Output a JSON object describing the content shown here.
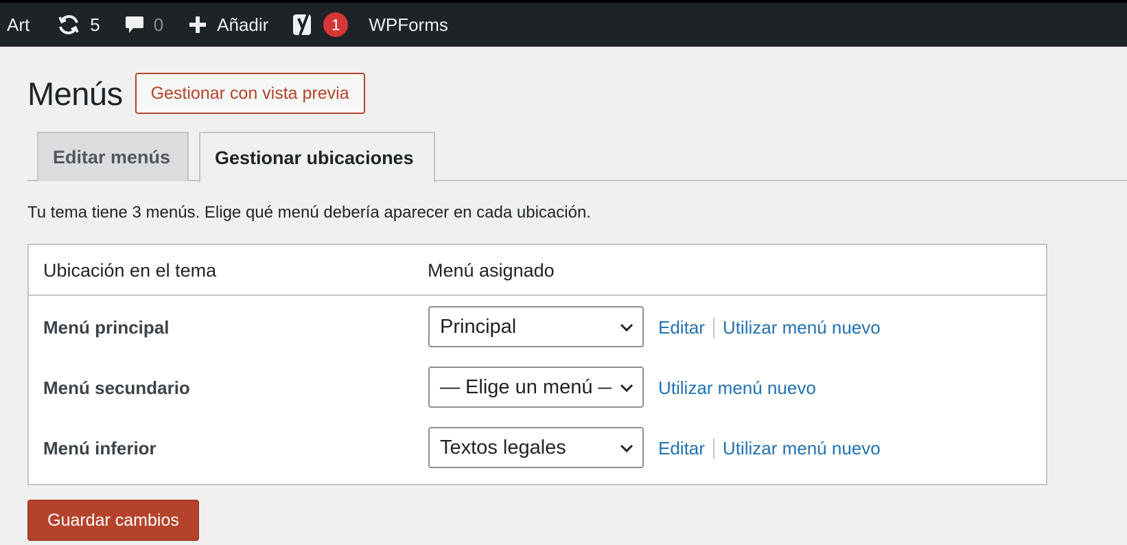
{
  "adminbar": {
    "site_name": "Art",
    "updates_count": "5",
    "comments_count": "0",
    "new_label": "Añadir",
    "yoast_count": "1",
    "wpforms_label": "WPForms"
  },
  "page": {
    "title": "Menús",
    "preview_button": "Gestionar con vista previa"
  },
  "tabs": [
    {
      "label": "Editar menús",
      "active": false
    },
    {
      "label": "Gestionar ubicaciones",
      "active": true
    }
  ],
  "intro_text": "Tu tema tiene 3 menús. Elige qué menú debería aparecer en cada ubicación.",
  "table": {
    "headers": [
      "Ubicación en el tema",
      "Menú asignado"
    ],
    "rows": [
      {
        "location": "Menú principal",
        "selected": "Principal",
        "edit_link": "Editar",
        "new_link": "Utilizar menú nuevo"
      },
      {
        "location": "Menú secundario",
        "selected": "— Elige un menú —",
        "edit_link": "",
        "new_link": "Utilizar menú nuevo"
      },
      {
        "location": "Menú inferior",
        "selected": "Textos legales",
        "edit_link": "Editar",
        "new_link": "Utilizar menú nuevo"
      }
    ]
  },
  "save_button": "Guardar cambios",
  "colors": {
    "accent": "#b5432b",
    "link": "#2271b1",
    "adminbar_bg": "#1d2327",
    "badge": "#d63638"
  }
}
